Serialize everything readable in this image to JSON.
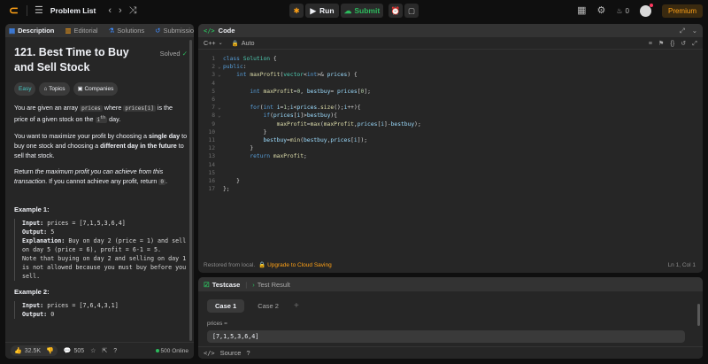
{
  "topbar": {
    "logo_glyph": "⊂",
    "problem_list": "Problem List",
    "run_label": "Run",
    "submit_label": "Submit",
    "streak_count": "0",
    "premium_label": "Premium"
  },
  "left_tabs": [
    {
      "label": "Description"
    },
    {
      "label": "Editorial"
    },
    {
      "label": "Solutions"
    },
    {
      "label": "Submissio"
    }
  ],
  "problem": {
    "title": "121. Best Time to Buy and Sell Stock",
    "solved_label": "Solved",
    "tags": [
      "Easy",
      "Topics",
      "Companies"
    ],
    "p1_a": "You are given an array ",
    "p1_code1": "prices",
    "p1_b": " where ",
    "p1_code2": "prices[i]",
    "p1_c": " is the price of a given stock on the ",
    "p1_code3": "i",
    "p1_sup": "th",
    "p1_d": " day.",
    "p2_a": "You want to maximize your profit by choosing a ",
    "p2_b1": "single day",
    "p2_c": " to buy one stock and choosing a ",
    "p2_b2": "different day in the future",
    "p2_d": " to sell that stock.",
    "p3_a": "Return ",
    "p3_i": "the maximum profit you can achieve from this transaction",
    "p3_b": ". If you cannot achieve any profit, return ",
    "p3_code": "0",
    "p3_c": "."
  },
  "example1": {
    "title": "Example 1:",
    "input_label": "Input:",
    "input_value": " prices = [7,1,5,3,6,4]",
    "output_label": "Output:",
    "output_value": " 5",
    "explanation_label": "Explanation:",
    "explanation_value": " Buy on day 2 (price = 1) and sell on day 5 (price = 6), profit = 6-1 = 5.",
    "note": "Note that buying on day 2 and selling on day 1 is not allowed because you must buy before you sell."
  },
  "example2": {
    "title": "Example 2:",
    "input_label": "Input:",
    "input_value": " prices = [7,6,4,3,1]",
    "output_label": "Output:",
    "output_value": " 0"
  },
  "left_footer": {
    "likes": "32.5K",
    "comments": "505",
    "online": "500 Online"
  },
  "code": {
    "tab_label": "Code",
    "tab_icon": "</>",
    "language": "C++",
    "mode": "Auto",
    "lines": [
      "class Solution {",
      "public:",
      "    int maxProfit(vector<int>& prices) {",
      "",
      "        int maxProfit=0, bestbuy= prices[0];",
      "",
      "        for(int i=1;i<prices.size();i++){",
      "            if(prices[i]>bestbuy){",
      "                maxProfit=max(maxProfit,prices[i]-bestbuy);",
      "            }",
      "            bestbuy=min(bestbuy,prices[i]);",
      "        }",
      "        return maxProfit;",
      "",
      "",
      "    }",
      "};"
    ],
    "line_numbers": [
      "1",
      "2",
      "3",
      "4",
      "5",
      "6",
      "7",
      "8",
      "9",
      "10",
      "11",
      "12",
      "13",
      "14",
      "15",
      "16",
      "17"
    ],
    "restored": "Restored from local.",
    "upgrade": "Upgrade to Cloud Saving",
    "cursor_pos": "Ln 1, Col 1"
  },
  "testcase": {
    "tab1": "Testcase",
    "tab2": "Test Result",
    "cases": [
      "Case 1",
      "Case 2"
    ],
    "param_label": "prices =",
    "param_value": "[7,1,5,3,6,4]",
    "source_label": "Source"
  }
}
